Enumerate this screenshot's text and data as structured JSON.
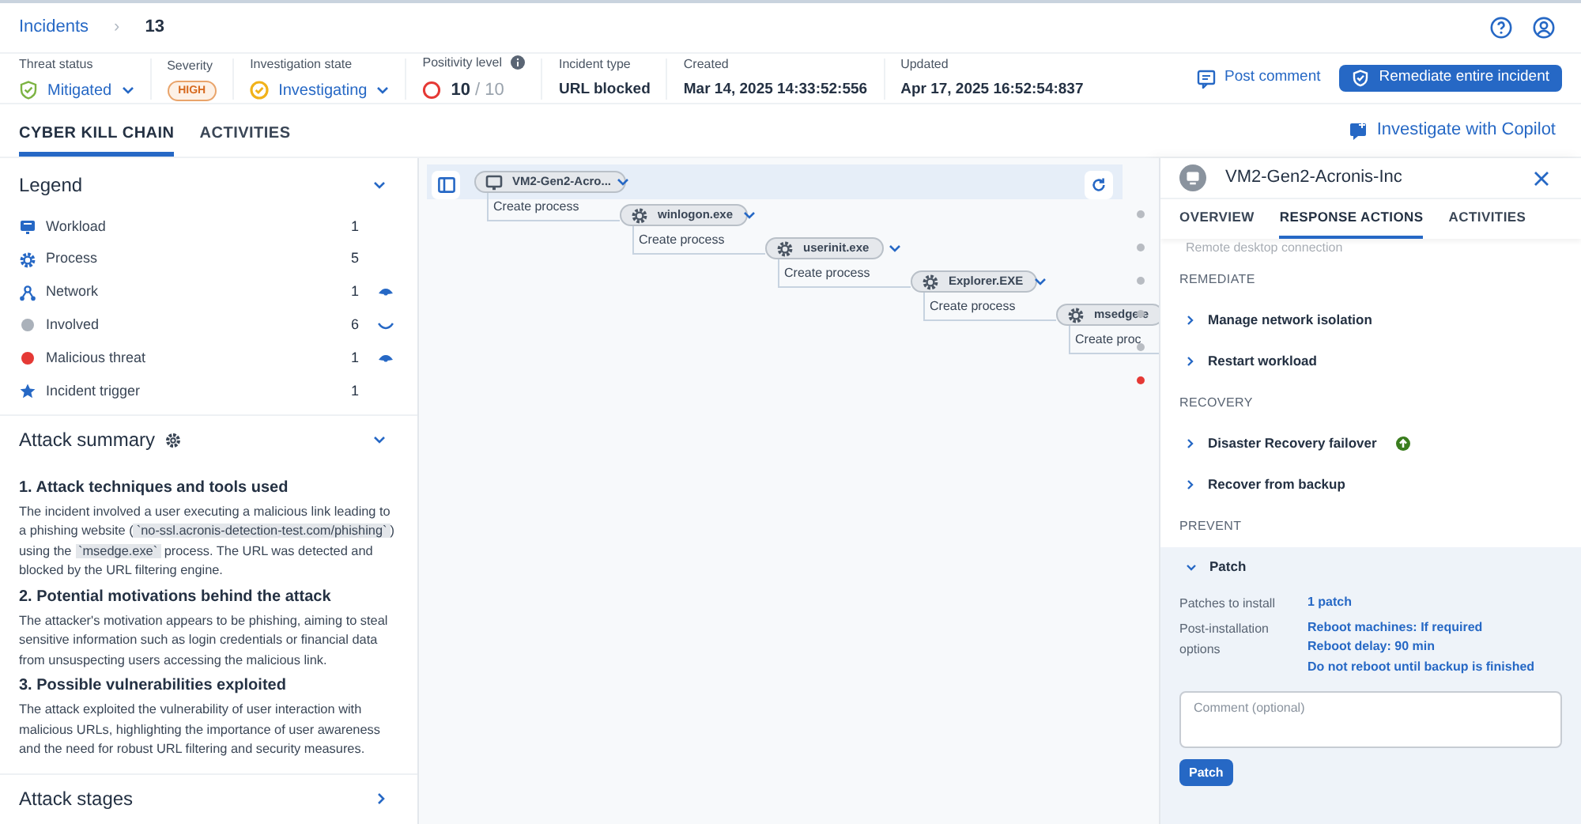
{
  "breadcrumb": {
    "parent": "Incidents",
    "separator": "›",
    "current": "13"
  },
  "info": [
    {
      "label": "Threat status",
      "value": "Mitigated",
      "kind": "status"
    },
    {
      "label": "Severity",
      "value": "HIGH",
      "kind": "badge"
    },
    {
      "label": "Investigation state",
      "value": "Investigating",
      "kind": "state"
    },
    {
      "label": "Positivity level",
      "value": "10",
      "total": "/ 10",
      "kind": "level"
    },
    {
      "label": "Incident type",
      "value": "URL blocked",
      "kind": "text"
    },
    {
      "label": "Created",
      "value": "Mar 14, 2025 14:33:52:556",
      "kind": "text"
    },
    {
      "label": "Updated",
      "value": "Apr 17, 2025 16:52:54:837",
      "kind": "text"
    }
  ],
  "actions": {
    "post_comment": "Post comment",
    "remediate": "Remediate entire incident",
    "copilot": "Investigate with Copilot"
  },
  "tabs": [
    {
      "label": "CYBER KILL CHAIN",
      "selected": true
    },
    {
      "label": "ACTIVITIES",
      "selected": false
    }
  ],
  "legend": {
    "title": "Legend",
    "items": [
      {
        "kind": "workload",
        "label": "Workload",
        "count": "1"
      },
      {
        "kind": "process",
        "label": "Process",
        "count": "5"
      },
      {
        "kind": "network",
        "label": "Network",
        "count": "1",
        "hidden": false
      },
      {
        "kind": "involved",
        "label": "Involved",
        "count": "6",
        "hidden": true
      },
      {
        "kind": "malicious",
        "label": "Malicious threat",
        "count": "1",
        "hidden": false
      },
      {
        "kind": "trigger",
        "label": "Incident trigger",
        "count": "1"
      }
    ]
  },
  "attack_summary": {
    "title": "Attack summary",
    "sections": [
      {
        "heading": "1. Attack techniques and tools used",
        "parts": [
          {
            "text": "The incident involved a user executing a malicious link leading to a phishing website ("
          },
          {
            "code": "`no-ssl.acronis-detection-test.com/phishing`"
          },
          {
            "text": ") using the "
          },
          {
            "code": "`msedge.exe`"
          },
          {
            "text": " process. The URL was detected and blocked by the URL filtering engine."
          }
        ]
      },
      {
        "heading": "2. Potential motivations behind the attack",
        "parts": [
          {
            "text": "The attacker's motivation appears to be phishing, aiming to steal sensitive information such as login credentials or financial data from unsuspecting users accessing the malicious link."
          }
        ]
      },
      {
        "heading": "3. Possible vulnerabilities exploited",
        "parts": [
          {
            "text": "The attack exploited the vulnerability of user interaction with malicious URLs, highlighting the importance of user awareness and the need for robust URL filtering and security measures."
          }
        ]
      }
    ]
  },
  "attack_stages": {
    "title": "Attack stages"
  },
  "graph": {
    "nodes": [
      {
        "kind": "workload",
        "label": "VM2-Gen2-Acro...",
        "edge": "Create process"
      },
      {
        "kind": "process",
        "label": "winlogon.exe",
        "edge": "Create process"
      },
      {
        "kind": "process",
        "label": "userinit.exe",
        "edge": "Create process"
      },
      {
        "kind": "process",
        "label": "Explorer.EXE",
        "edge": "Create process"
      },
      {
        "kind": "process",
        "label": "msedge.e",
        "edge": "Create proc"
      }
    ],
    "dots": [
      {
        "color": "#b8bcc2"
      },
      {
        "color": "#b8bcc2"
      },
      {
        "color": "#b8bcc2"
      },
      {
        "color": "#b8bcc2"
      },
      {
        "color": "#b8bcc2"
      },
      {
        "color": "#e53935"
      }
    ]
  },
  "panel": {
    "title": "VM2-Gen2-Acronis-Inc",
    "tabs": [
      {
        "label": "OVERVIEW",
        "selected": false
      },
      {
        "label": "RESPONSE ACTIONS",
        "selected": true
      },
      {
        "label": "ACTIVITIES",
        "selected": false
      }
    ],
    "partial_item": "Remote desktop connection",
    "groups": [
      {
        "title": "REMEDIATE",
        "items": [
          {
            "label": "Manage network isolation",
            "expanded": false
          },
          {
            "label": "Restart workload",
            "expanded": false
          }
        ]
      },
      {
        "title": "RECOVERY",
        "items": [
          {
            "label": "Disaster Recovery failover",
            "expanded": false,
            "upgrade": true
          },
          {
            "label": "Recover from backup",
            "expanded": false
          }
        ]
      },
      {
        "title": "PREVENT",
        "items": [
          {
            "label": "Patch",
            "expanded": true
          }
        ]
      }
    ],
    "patch": {
      "rows": [
        {
          "label": "Patches to install",
          "values": [
            "1 patch"
          ]
        },
        {
          "label": "Post-installation options",
          "values": [
            "Reboot machines: If required",
            "Reboot delay: 90 min",
            "Do not reboot until backup is finished"
          ]
        }
      ],
      "comment_placeholder": "Comment (optional)",
      "button": "Patch"
    }
  }
}
